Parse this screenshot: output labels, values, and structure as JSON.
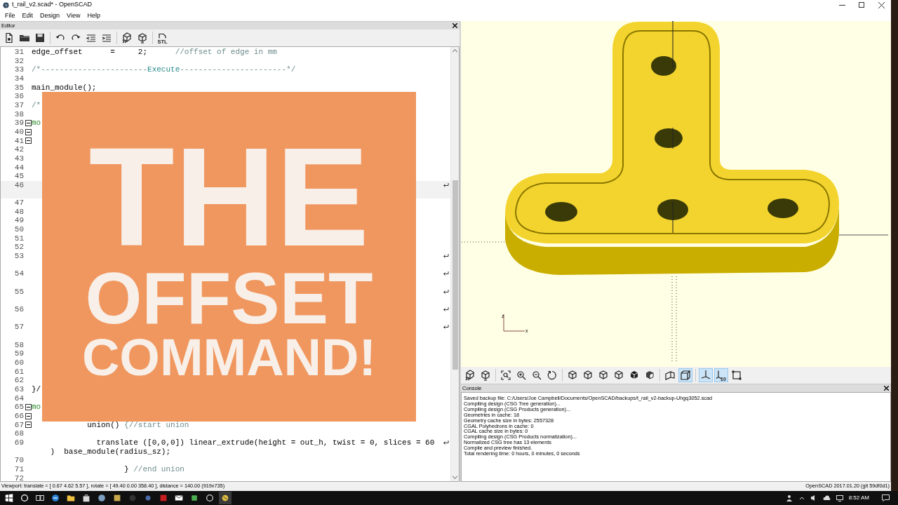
{
  "window": {
    "title": "t_rail_v2.scad* - OpenSCAD"
  },
  "menu": [
    "File",
    "Edit",
    "Design",
    "View",
    "Help"
  ],
  "editor": {
    "title": "Editor",
    "toolbar": [
      {
        "kind": "new"
      },
      {
        "kind": "open"
      },
      {
        "kind": "save"
      },
      {
        "kind": "separator"
      },
      {
        "kind": "undo"
      },
      {
        "kind": "redo"
      },
      {
        "kind": "unindent"
      },
      {
        "kind": "indent"
      },
      {
        "kind": "separator"
      },
      {
        "kind": "preview"
      },
      {
        "kind": "render"
      },
      {
        "kind": "separator"
      },
      {
        "kind": "export",
        "label": "STL"
      }
    ],
    "lines": [
      {
        "num": "31",
        "parts": [
          {
            "text": "edge_offset      =     2;      ",
            "kind": "code"
          },
          {
            "text": "//offset of edge in mm",
            "kind": "comment"
          }
        ],
        "wrapped": false,
        "fold": false,
        "current": false
      },
      {
        "num": "32",
        "wrapped": false,
        "fold": false,
        "current": false
      },
      {
        "num": "33",
        "parts": [
          {
            "text": "/*-----------------------",
            "kind": "comment"
          },
          {
            "text": "Execute",
            "kind": "heading"
          },
          {
            "text": "-----------------------*/",
            "kind": "comment"
          }
        ],
        "wrapped": false,
        "fold": false,
        "current": false
      },
      {
        "num": "34",
        "wrapped": false,
        "fold": false,
        "current": false
      },
      {
        "num": "35",
        "parts": [
          {
            "text": "main_module();",
            "kind": "code"
          }
        ],
        "wrapped": false,
        "fold": false,
        "current": false
      },
      {
        "num": "36",
        "wrapped": false,
        "fold": false,
        "current": false
      },
      {
        "num": "37",
        "parts": [
          {
            "text": "/*",
            "kind": "comment"
          }
        ],
        "wrapped": false,
        "fold": false,
        "current": false
      },
      {
        "num": "38",
        "wrapped": false,
        "fold": false,
        "current": false
      },
      {
        "num": "39",
        "parts": [
          {
            "text": "mo",
            "kind": "keyword"
          }
        ],
        "wrapped": false,
        "fold": true,
        "current": false
      },
      {
        "num": "40",
        "wrapped": false,
        "fold": true,
        "current": false
      },
      {
        "num": "41",
        "wrapped": false,
        "fold": true,
        "current": false
      },
      {
        "num": "42",
        "wrapped": false,
        "fold": false,
        "current": false
      },
      {
        "num": "43",
        "wrapped": false,
        "fold": false,
        "current": false
      },
      {
        "num": "44",
        "wrapped": false,
        "fold": false,
        "current": false
      },
      {
        "num": "45",
        "wrapped": false,
        "fold": false,
        "current": false
      },
      {
        "num": "46",
        "wrapped": true,
        "fold": false,
        "current": true
      },
      {
        "num": "47",
        "wrapped": false,
        "fold": false,
        "current": false
      },
      {
        "num": "48",
        "wrapped": false,
        "fold": false,
        "current": false
      },
      {
        "num": "49",
        "wrapped": false,
        "fold": false,
        "current": false
      },
      {
        "num": "50",
        "wrapped": false,
        "fold": false,
        "current": false
      },
      {
        "num": "51",
        "wrapped": false,
        "fold": false,
        "current": false
      },
      {
        "num": "52",
        "wrapped": false,
        "fold": false,
        "current": false
      },
      {
        "num": "53",
        "wrapped": true,
        "fold": false,
        "current": false
      },
      {
        "num": "54",
        "wrapped": true,
        "fold": false,
        "current": false
      },
      {
        "num": "55",
        "wrapped": true,
        "fold": false,
        "current": false
      },
      {
        "num": "56",
        "wrapped": true,
        "fold": false,
        "current": false
      },
      {
        "num": "57",
        "wrapped": true,
        "fold": false,
        "current": false
      },
      {
        "num": "58",
        "wrapped": false,
        "fold": false,
        "current": false
      },
      {
        "num": "59",
        "wrapped": false,
        "fold": false,
        "current": false
      },
      {
        "num": "60",
        "wrapped": false,
        "fold": false,
        "current": false
      },
      {
        "num": "61",
        "wrapped": false,
        "fold": false,
        "current": false
      },
      {
        "num": "62",
        "wrapped": false,
        "fold": false,
        "current": false
      },
      {
        "num": "63",
        "parts": [
          {
            "text": "}/",
            "kind": "code"
          }
        ],
        "wrapped": false,
        "fold": false,
        "current": false
      },
      {
        "num": "64",
        "wrapped": false,
        "fold": false,
        "current": false
      },
      {
        "num": "65",
        "parts": [
          {
            "text": "mo",
            "kind": "keyword"
          }
        ],
        "wrapped": false,
        "fold": true,
        "current": false
      },
      {
        "num": "66",
        "wrapped": false,
        "fold": true,
        "current": false
      },
      {
        "num": "67",
        "parts": [
          {
            "text": "            union() ",
            "kind": "code"
          },
          {
            "text": "{//start union",
            "kind": "comment"
          }
        ],
        "wrapped": false,
        "fold": true,
        "current": false
      },
      {
        "num": "68",
        "wrapped": false,
        "fold": false,
        "current": false
      },
      {
        "num": "69",
        "parts": [
          {
            "text": "              translate ([0,0,0]) linear_extrude(height = out_h, twist = 0, slices = 60",
            "kind": "code"
          }
        ],
        "continuation": [
          {
            "text": "    )  base_module(radius_sz);",
            "kind": "code"
          }
        ],
        "wrapped": true,
        "fold": false,
        "current": false
      },
      {
        "num": "70",
        "wrapped": false,
        "fold": false,
        "current": false
      },
      {
        "num": "71",
        "parts": [
          {
            "text": "                    } ",
            "kind": "code"
          },
          {
            "text": "//end union",
            "kind": "comment"
          }
        ],
        "wrapped": false,
        "fold": false,
        "current": false
      },
      {
        "num": "72",
        "wrapped": false,
        "fold": false,
        "current": false
      }
    ]
  },
  "overlay": {
    "lines": [
      "THE",
      "OFFSET",
      "COMMAND!"
    ]
  },
  "viewport": {
    "axis_labels": [
      "z",
      "x"
    ],
    "toolbar": [
      {
        "kind": "preview",
        "selected": false
      },
      {
        "kind": "render",
        "selected": false
      },
      {
        "kind": "separator"
      },
      {
        "kind": "view-all",
        "selected": false
      },
      {
        "kind": "zoom-in",
        "selected": false
      },
      {
        "kind": "zoom-out",
        "selected": false
      },
      {
        "kind": "reset",
        "selected": false
      },
      {
        "kind": "separator"
      },
      {
        "kind": "view-right",
        "selected": false
      },
      {
        "kind": "view-top",
        "selected": false
      },
      {
        "kind": "view-bottom",
        "selected": false
      },
      {
        "kind": "view-left",
        "selected": false
      },
      {
        "kind": "view-front",
        "selected": false
      },
      {
        "kind": "view-back",
        "selected": false
      },
      {
        "kind": "separator"
      },
      {
        "kind": "perspective",
        "selected": false
      },
      {
        "kind": "orthogonal",
        "selected": true
      },
      {
        "kind": "separator"
      },
      {
        "kind": "axes",
        "selected": true
      },
      {
        "kind": "scale",
        "label": "10",
        "selected": true
      },
      {
        "kind": "edges",
        "selected": false
      }
    ]
  },
  "console": {
    "title": "Console",
    "lines": [
      "Saved backup file: C:/Users/Joe Campbell/Documents/OpenSCAD/backups/t_rail_v2-backup-Uhgq3052.scad",
      "Compiling design (CSG Tree generation)...",
      "Compiling design (CSG Products generation)...",
      "Geometries in cache: 18",
      "Geometry cache size in bytes: 2557328",
      "CGAL Polyhedrons in cache: 0",
      "CGAL cache size in bytes: 0",
      "Compiling design (CSG Products normalization)...",
      "Normalized CSG tree has 13 elements",
      "Compile and preview finished.",
      "Total rendering time: 0 hours, 0 minutes, 0 seconds"
    ]
  },
  "status_bar": {
    "left": "Viewport: translate = [ 0.67 4.62 5.57 ], rotate = [ 49.40 0.00 358.40 ], distance = 140.00 (919x735)",
    "right": "OpenSCAD 2017.01.20 (git 59df0d1)"
  },
  "taskbar": {
    "clock": "8:52 AM"
  }
}
